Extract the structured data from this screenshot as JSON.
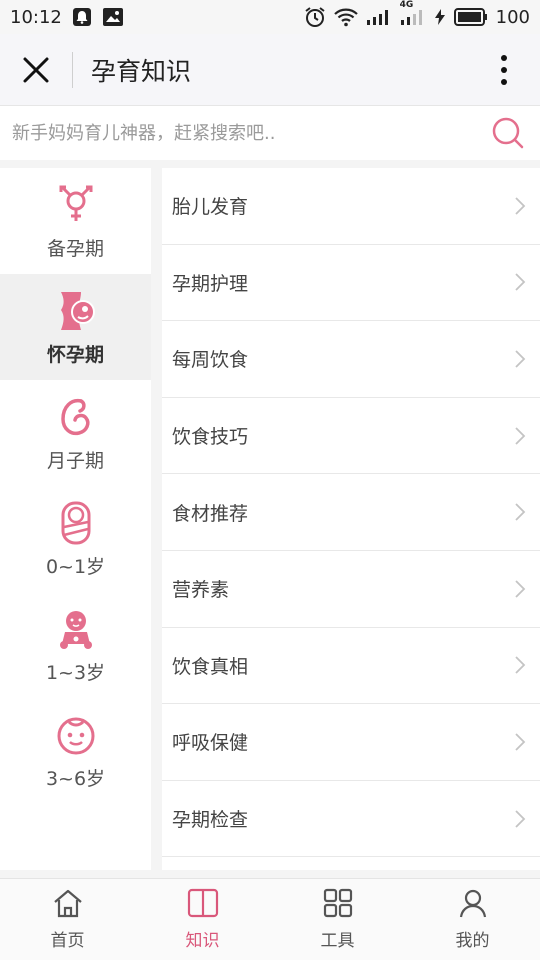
{
  "status_bar": {
    "time": "10:12",
    "battery": "100",
    "network": "4G"
  },
  "app_bar": {
    "title": "孕育知识"
  },
  "search": {
    "placeholder": "新手妈妈育儿神器，赶紧搜索吧.."
  },
  "sidebar": {
    "items": [
      {
        "label": "备孕期",
        "icon": "gender-icon",
        "active": false
      },
      {
        "label": "怀孕期",
        "icon": "pregnant-icon",
        "active": true
      },
      {
        "label": "月子期",
        "icon": "postpartum-icon",
        "active": false
      },
      {
        "label": "0~1岁",
        "icon": "swaddled-baby-icon",
        "active": false
      },
      {
        "label": "1~3岁",
        "icon": "toddler-icon",
        "active": false
      },
      {
        "label": "3~6岁",
        "icon": "child-face-icon",
        "active": false
      }
    ]
  },
  "topics": [
    {
      "label": "胎儿发育"
    },
    {
      "label": "孕期护理"
    },
    {
      "label": "每周饮食"
    },
    {
      "label": "饮食技巧"
    },
    {
      "label": "食材推荐"
    },
    {
      "label": "营养素"
    },
    {
      "label": "饮食真相"
    },
    {
      "label": "呼吸保健"
    },
    {
      "label": "孕期检查"
    }
  ],
  "bottom_nav": {
    "items": [
      {
        "label": "首页",
        "icon": "home-icon",
        "active": false
      },
      {
        "label": "知识",
        "icon": "book-icon",
        "active": true
      },
      {
        "label": "工具",
        "icon": "grid-icon",
        "active": false
      },
      {
        "label": "我的",
        "icon": "user-icon",
        "active": false
      }
    ]
  },
  "colors": {
    "accent": "#e46f8d",
    "active_text": "#d9577a",
    "background": "#f4f4f4"
  }
}
